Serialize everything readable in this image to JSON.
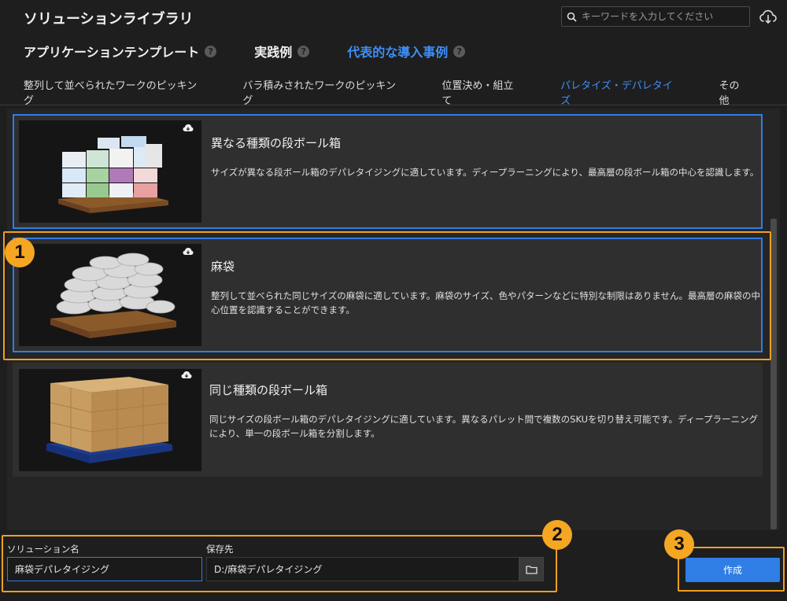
{
  "header": {
    "title": "ソリューションライブラリ",
    "search_placeholder": "キーワードを入力してください"
  },
  "main_tabs": [
    {
      "label": "アプリケーションテンプレート",
      "help": "?"
    },
    {
      "label": "実践例",
      "help": "?"
    },
    {
      "label": "代表的な導入事例",
      "help": "?",
      "active": true
    }
  ],
  "sub_tabs": [
    {
      "label": "整列して並べられたワークのピッキング"
    },
    {
      "label": "バラ積みされたワークのピッキング"
    },
    {
      "label": "位置決め・組立て"
    },
    {
      "label": "パレタイズ・デパレタイズ",
      "active": true
    },
    {
      "label": "その他"
    }
  ],
  "cards": [
    {
      "title": "異なる種類の段ボール箱",
      "description": "サイズが異なる段ボール箱のデパレタイジングに適しています。ディープラーニングにより、最高層の段ボール箱の中心を認識します。"
    },
    {
      "title": "麻袋",
      "description": "整列して並べられた同じサイズの麻袋に適しています。麻袋のサイズ、色やパターンなどに特別な制限はありません。最高層の麻袋の中心位置を認識することができます。"
    },
    {
      "title": "同じ種類の段ボール箱",
      "description": "同じサイズの段ボール箱のデパレタイジングに適しています。異なるパレット間で複数のSKUを切り替え可能です。ディープラーニングにより、単一の段ボール箱を分割します。"
    }
  ],
  "form": {
    "solution_name_label": "ソリューション名",
    "solution_name_value": "麻袋デパレタイジング",
    "save_to_label": "保存先",
    "save_to_value": "D:/麻袋デパレタイジング",
    "create_label": "作成"
  },
  "badges": [
    "1",
    "2",
    "3"
  ],
  "colors": {
    "accent": "#3e8ef7",
    "highlight": "#f5a623",
    "background": "#1e1e1e"
  }
}
